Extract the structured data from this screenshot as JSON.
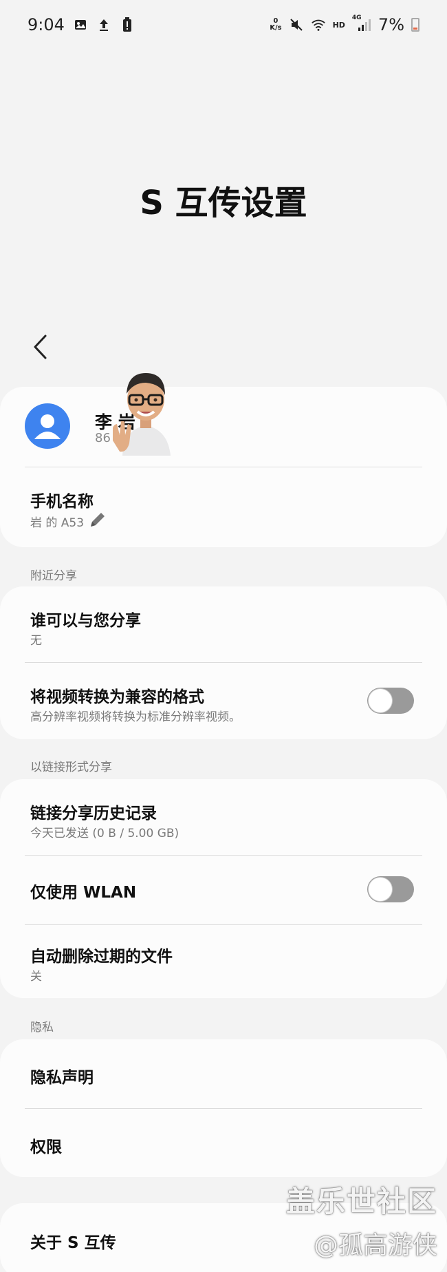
{
  "status_bar": {
    "time": "9:04",
    "net_speed_value": "0",
    "net_speed_unit": "K/s",
    "hd": "HD",
    "network": "4G",
    "battery": "7%"
  },
  "page": {
    "title": "S 互传设置"
  },
  "profile": {
    "name": "李 岩",
    "number": "86 1 ... 26"
  },
  "device": {
    "title": "手机名称",
    "value": "岩 的 A53"
  },
  "sections": {
    "nearby": "附近分享",
    "link": "以链接形式分享",
    "privacy": "隐私"
  },
  "nearby": {
    "who_title": "谁可以与您分享",
    "who_value": "无",
    "convert_title": "将视频转换为兼容的格式",
    "convert_sub": "高分辨率视频将转换为标准分辨率视频。",
    "convert_on": false
  },
  "link": {
    "history_title": "链接分享历史记录",
    "history_sub": "今天已发送 (0 B / 5.00 GB)",
    "wlan_title": "仅使用 WLAN",
    "wlan_on": false,
    "autodelete_title": "自动删除过期的文件",
    "autodelete_value": "关"
  },
  "privacy": {
    "statement": "隐私声明",
    "permissions": "权限"
  },
  "about": {
    "title": "关于 S 互传"
  },
  "watermark": {
    "line1": "盖乐世社区",
    "line2": "@孤高游侠"
  }
}
